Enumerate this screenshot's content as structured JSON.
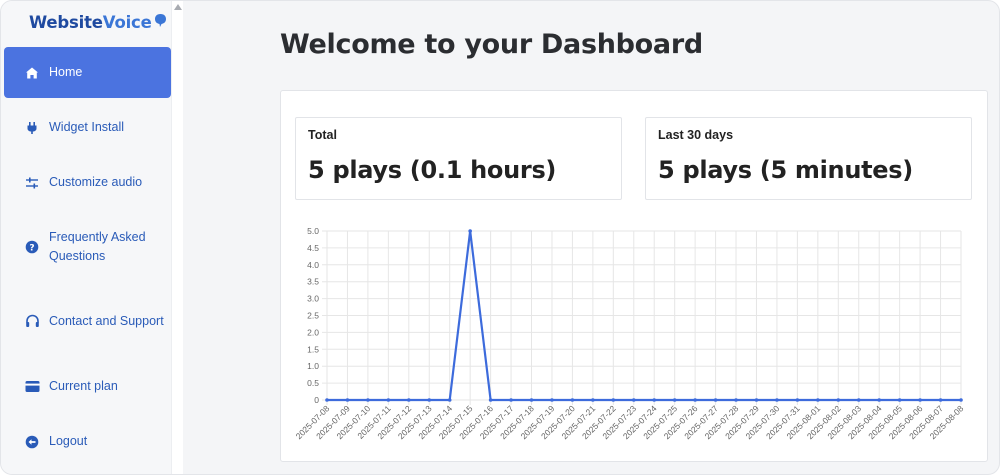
{
  "app": {
    "logo_part1": "Website",
    "logo_part2": "Voice",
    "page_title": "Welcome to your Dashboard"
  },
  "sidebar": {
    "items": [
      {
        "label": "Home",
        "icon": "home-icon",
        "active": true
      },
      {
        "label": "Widget Install",
        "icon": "plug-icon",
        "active": false
      },
      {
        "label": "Customize audio",
        "icon": "sliders-icon",
        "active": false
      },
      {
        "label": "Frequently Asked Questions",
        "icon": "question-circle-icon",
        "active": false
      },
      {
        "label": "Contact and Support",
        "icon": "headphones-icon",
        "active": false
      },
      {
        "label": "Current plan",
        "icon": "credit-card-icon",
        "active": false
      },
      {
        "label": "Logout",
        "icon": "logout-icon",
        "active": false
      }
    ]
  },
  "stats": {
    "total": {
      "title": "Total",
      "value": "5 plays (0.1 hours)"
    },
    "last30": {
      "title": "Last 30 days",
      "value": "5 plays (5 minutes)"
    }
  },
  "colors": {
    "accent": "#4b73e0",
    "nav_text": "#2a5bb8",
    "line": "#3d6bdc"
  },
  "chart_data": {
    "type": "line",
    "x": [
      "2025-07-08",
      "2025-07-09",
      "2025-07-10",
      "2025-07-11",
      "2025-07-12",
      "2025-07-13",
      "2025-07-14",
      "2025-07-15",
      "2025-07-16",
      "2025-07-17",
      "2025-07-18",
      "2025-07-19",
      "2025-07-20",
      "2025-07-21",
      "2025-07-22",
      "2025-07-23",
      "2025-07-24",
      "2025-07-25",
      "2025-07-26",
      "2025-07-27",
      "2025-07-28",
      "2025-07-29",
      "2025-07-30",
      "2025-07-31",
      "2025-08-01",
      "2025-08-02",
      "2025-08-03",
      "2025-08-04",
      "2025-08-05",
      "2025-08-06",
      "2025-08-07",
      "2025-08-08"
    ],
    "series": [
      {
        "values": [
          0,
          0,
          0,
          0,
          0,
          0,
          0,
          5,
          0,
          0,
          0,
          0,
          0,
          0,
          0,
          0,
          0,
          0,
          0,
          0,
          0,
          0,
          0,
          0,
          0,
          0,
          0,
          0,
          0,
          0,
          0,
          0
        ]
      }
    ],
    "yticks": [
      "0",
      "0.5",
      "1.0",
      "1.5",
      "2.0",
      "2.5",
      "3.0",
      "3.5",
      "4.0",
      "4.5",
      "5.0"
    ],
    "ylim": [
      0,
      5
    ],
    "grid": true
  }
}
